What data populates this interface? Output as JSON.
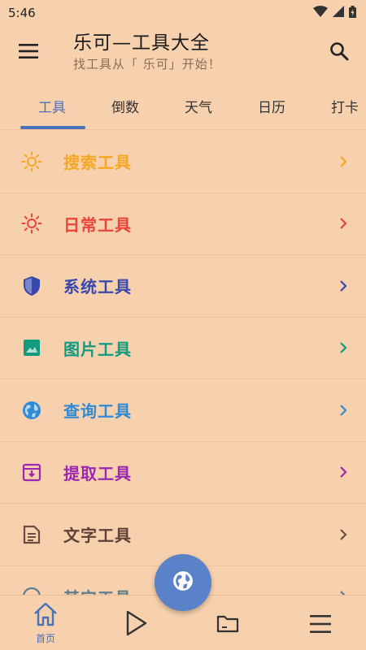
{
  "status_bar": {
    "time": "5:46"
  },
  "app_bar": {
    "title": "乐可—工具大全",
    "subtitle": "找工具从「 乐可」开始！"
  },
  "tabs": [
    {
      "label": "工具",
      "active": true
    },
    {
      "label": "倒数",
      "active": false
    },
    {
      "label": "天气",
      "active": false
    },
    {
      "label": "日历",
      "active": false
    },
    {
      "label": "打卡",
      "active": false
    }
  ],
  "tools": [
    {
      "label": "搜索工具",
      "icon": "sun-outline-icon",
      "color": "#f5a623"
    },
    {
      "label": "日常工具",
      "icon": "sun-icon",
      "color": "#e8443a"
    },
    {
      "label": "系统工具",
      "icon": "shield-icon",
      "color": "#3949ab"
    },
    {
      "label": "图片工具",
      "icon": "image-icon",
      "color": "#129a7f"
    },
    {
      "label": "查询工具",
      "icon": "globe-icon",
      "color": "#2f8ad6"
    },
    {
      "label": "提取工具",
      "icon": "archive-icon",
      "color": "#9c27b0"
    },
    {
      "label": "文字工具",
      "icon": "document-icon",
      "color": "#6d4c41"
    },
    {
      "label": "其它工具",
      "icon": "circle-icon",
      "color": "#607d8b"
    }
  ],
  "bottom_nav": [
    {
      "label": "首页",
      "icon": "home-icon",
      "active": true
    },
    {
      "label": "",
      "icon": "play-icon",
      "active": false
    },
    {
      "label": "",
      "icon": "folder-icon",
      "active": false
    },
    {
      "label": "",
      "icon": "menu-icon",
      "active": false
    }
  ],
  "fab": {
    "icon": "globe-icon"
  },
  "accent_color": "#4a72b8"
}
